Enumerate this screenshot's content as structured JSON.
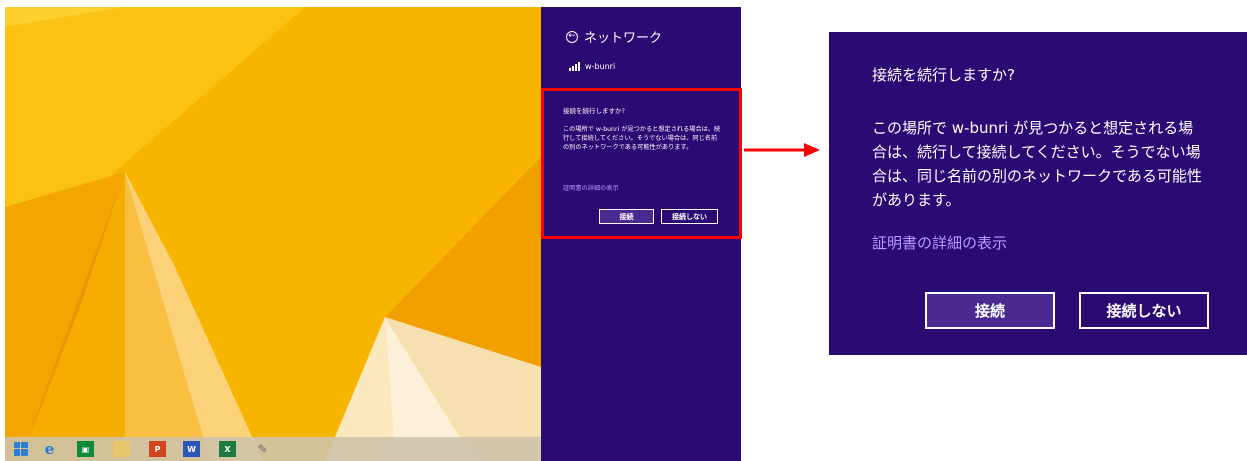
{
  "charm": {
    "title": "ネットワーク",
    "network_name": "w-bunri"
  },
  "dialog": {
    "question": "接続を続行しますか?",
    "message": "この場所で w-bunri が見つかると想定される場合は、続行して接続してください。そうでない場合は、同じ名前の別のネットワークである可能性があります。",
    "cert_link": "証明書の詳細の表示",
    "connect_label": "接続",
    "dont_connect_label": "接続しない"
  },
  "taskbar": {
    "icons": [
      "windows-start-icon",
      "internet-explorer-icon",
      "store-icon",
      "file-explorer-icon",
      "powerpoint-icon",
      "word-icon",
      "excel-icon",
      "paint-icon"
    ]
  },
  "colors": {
    "charm_background": "#2a0a73",
    "link": "#b79cff",
    "highlight": "#ff0000",
    "wallpaper_yellow": "#f7b400"
  }
}
